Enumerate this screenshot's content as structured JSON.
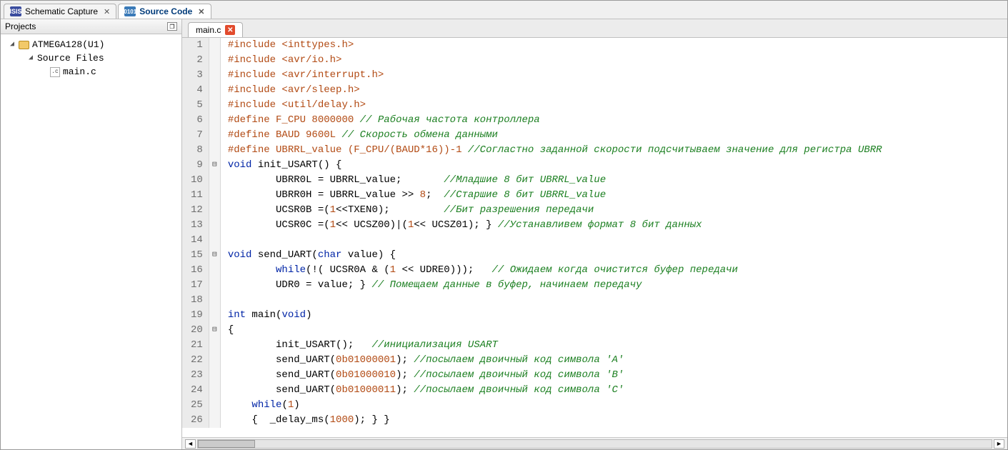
{
  "topTabs": [
    {
      "label": "Schematic Capture",
      "active": false
    },
    {
      "label": "Source Code",
      "active": true
    }
  ],
  "projectsPanel": {
    "title": "Projects",
    "root": {
      "label": "ATMEGA128(U1)"
    },
    "folder": {
      "label": "Source Files"
    },
    "file": {
      "label": "main.c"
    }
  },
  "fileTabs": [
    {
      "label": "main.c"
    }
  ],
  "code": {
    "lines": [
      {
        "n": 1,
        "fold": "",
        "tokens": [
          [
            "pp",
            "#include <inttypes.h>"
          ]
        ]
      },
      {
        "n": 2,
        "fold": "",
        "tokens": [
          [
            "pp",
            "#include <avr/io.h>"
          ]
        ]
      },
      {
        "n": 3,
        "fold": "",
        "tokens": [
          [
            "pp",
            "#include <avr/interrupt.h>"
          ]
        ]
      },
      {
        "n": 4,
        "fold": "",
        "tokens": [
          [
            "pp",
            "#include <avr/sleep.h>"
          ]
        ]
      },
      {
        "n": 5,
        "fold": "",
        "tokens": [
          [
            "pp",
            "#include <util/delay.h>"
          ]
        ]
      },
      {
        "n": 6,
        "fold": "",
        "tokens": [
          [
            "pp",
            "#define F_CPU 8000000 "
          ],
          [
            "cm",
            "// Рабочая частота контроллера"
          ]
        ]
      },
      {
        "n": 7,
        "fold": "",
        "tokens": [
          [
            "pp",
            "#define BAUD 9600L "
          ],
          [
            "cm",
            "// Скорость обмена данными"
          ]
        ]
      },
      {
        "n": 8,
        "fold": "",
        "tokens": [
          [
            "pp",
            "#define UBRRL_value (F_CPU/(BAUD*16))-1 "
          ],
          [
            "cm",
            "//Согластно заданной скорости подсчитываем значение для регистра UBRR"
          ]
        ]
      },
      {
        "n": 9,
        "fold": "−",
        "tokens": [
          [
            "kw",
            "void"
          ],
          [
            "id",
            " init_USART"
          ],
          [
            "id",
            "() {"
          ]
        ]
      },
      {
        "n": 10,
        "fold": "",
        "tokens": [
          [
            "id",
            "        UBRR0L = UBRRL_value;       "
          ],
          [
            "cm",
            "//Младшие 8 бит UBRRL_value"
          ]
        ]
      },
      {
        "n": 11,
        "fold": "",
        "tokens": [
          [
            "id",
            "        UBRR0H = UBRRL_value >> "
          ],
          [
            "num",
            "8"
          ],
          [
            "id",
            ";  "
          ],
          [
            "cm",
            "//Старшие 8 бит UBRRL_value"
          ]
        ]
      },
      {
        "n": 12,
        "fold": "",
        "tokens": [
          [
            "id",
            "        UCSR0B =("
          ],
          [
            "num",
            "1"
          ],
          [
            "id",
            "<<TXEN0);         "
          ],
          [
            "cm",
            "//Бит разрешения передачи"
          ]
        ]
      },
      {
        "n": 13,
        "fold": "",
        "tokens": [
          [
            "id",
            "        UCSR0C =("
          ],
          [
            "num",
            "1"
          ],
          [
            "id",
            "<< UCSZ00)|("
          ],
          [
            "num",
            "1"
          ],
          [
            "id",
            "<< UCSZ01); } "
          ],
          [
            "cm",
            "//Устанавливем формат 8 бит данных"
          ]
        ]
      },
      {
        "n": 14,
        "fold": "",
        "tokens": [
          [
            "id",
            ""
          ]
        ]
      },
      {
        "n": 15,
        "fold": "−",
        "tokens": [
          [
            "kw",
            "void"
          ],
          [
            "id",
            " send_UART("
          ],
          [
            "kw",
            "char"
          ],
          [
            "id",
            " value) {"
          ]
        ]
      },
      {
        "n": 16,
        "fold": "",
        "tokens": [
          [
            "id",
            "        "
          ],
          [
            "kw",
            "while"
          ],
          [
            "id",
            "(!( UCSR0A & ("
          ],
          [
            "num",
            "1"
          ],
          [
            "id",
            " << UDRE0)));   "
          ],
          [
            "cm",
            "// Ожидаем когда очистится буфер передачи"
          ]
        ]
      },
      {
        "n": 17,
        "fold": "",
        "tokens": [
          [
            "id",
            "        UDR0 = value; } "
          ],
          [
            "cm",
            "// Помещаем данные в буфер, начинаем передачу"
          ]
        ]
      },
      {
        "n": 18,
        "fold": "",
        "tokens": [
          [
            "id",
            ""
          ]
        ]
      },
      {
        "n": 19,
        "fold": "",
        "tokens": [
          [
            "kw",
            "int"
          ],
          [
            "id",
            " main("
          ],
          [
            "kw",
            "void"
          ],
          [
            "id",
            ")"
          ]
        ]
      },
      {
        "n": 20,
        "fold": "−",
        "tokens": [
          [
            "id",
            "{"
          ]
        ]
      },
      {
        "n": 21,
        "fold": "",
        "tokens": [
          [
            "id",
            "        init_USART();   "
          ],
          [
            "cm",
            "//инициализация USART"
          ]
        ]
      },
      {
        "n": 22,
        "fold": "",
        "tokens": [
          [
            "id",
            "        send_UART("
          ],
          [
            "num",
            "0b01000001"
          ],
          [
            "id",
            "); "
          ],
          [
            "cm",
            "//посылаем двоичный код символа 'A'"
          ]
        ]
      },
      {
        "n": 23,
        "fold": "",
        "tokens": [
          [
            "id",
            "        send_UART("
          ],
          [
            "num",
            "0b01000010"
          ],
          [
            "id",
            "); "
          ],
          [
            "cm",
            "//посылаем двоичный код символа 'B'"
          ]
        ]
      },
      {
        "n": 24,
        "fold": "",
        "tokens": [
          [
            "id",
            "        send_UART("
          ],
          [
            "num",
            "0b01000011"
          ],
          [
            "id",
            "); "
          ],
          [
            "cm",
            "//посылаем двоичный код символа 'C'"
          ]
        ]
      },
      {
        "n": 25,
        "fold": "",
        "tokens": [
          [
            "id",
            "    "
          ],
          [
            "kw",
            "while"
          ],
          [
            "id",
            "("
          ],
          [
            "num",
            "1"
          ],
          [
            "id",
            ")"
          ]
        ]
      },
      {
        "n": 26,
        "fold": "",
        "tokens": [
          [
            "id",
            "    {  _delay_ms("
          ],
          [
            "num",
            "1000"
          ],
          [
            "id",
            "); } }"
          ]
        ]
      }
    ]
  }
}
